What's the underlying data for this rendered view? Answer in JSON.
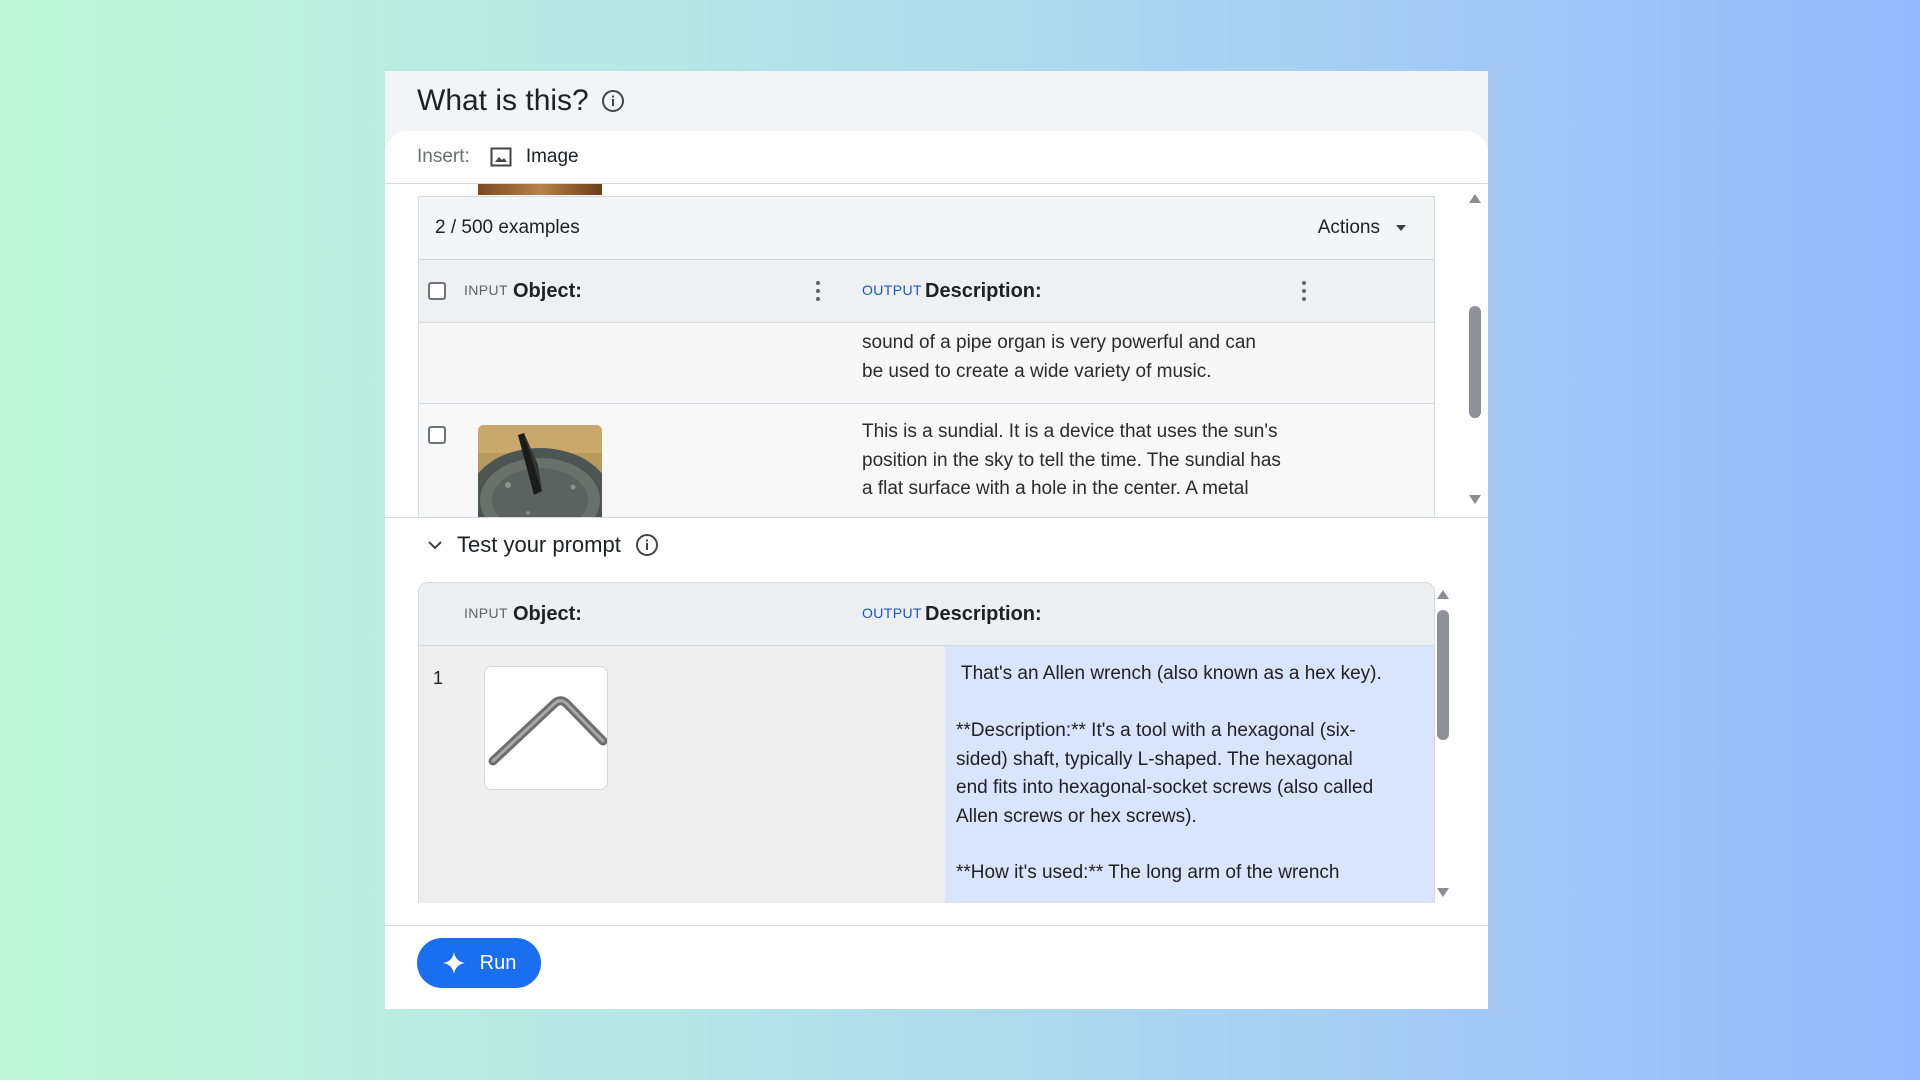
{
  "page": {
    "title": "What is this?"
  },
  "insert": {
    "label": "Insert:",
    "image_button": "Image"
  },
  "examples": {
    "count_label": "2 / 500 examples",
    "actions_label": "Actions",
    "input_tag": "INPUT",
    "input_column": "Object:",
    "output_tag": "OUTPUT",
    "output_column": "Description:",
    "rows": [
      {
        "output_lines": [
          "sound of a pipe organ is very powerful and can",
          "be used to create a wide variety of music."
        ]
      },
      {
        "output_lines": [
          "This is a sundial. It is a device that uses the sun's",
          "position in the sky to tell the time. The sundial has",
          "a flat surface with a hole in the center. A metal"
        ]
      }
    ]
  },
  "test": {
    "title": "Test your prompt",
    "input_tag": "INPUT",
    "input_column": "Object:",
    "output_tag": "OUTPUT",
    "output_column": "Description:",
    "row_number": "1",
    "output_p1": "That's an Allen wrench (also known as a hex key).",
    "output_p2_lines": [
      "**Description:**  It's a tool with a hexagonal (six-",
      "sided) shaft, typically L-shaped.  The hexagonal",
      "end fits into hexagonal-socket screws (also called",
      "Allen screws or hex screws)."
    ],
    "output_p3": "**How it's used:** The long arm of the wrench"
  },
  "footer": {
    "run_label": "Run"
  },
  "colors": {
    "accent": "#1a6ff0",
    "output_highlight": "#d9e4fd",
    "output_tag": "#1a56c9"
  }
}
